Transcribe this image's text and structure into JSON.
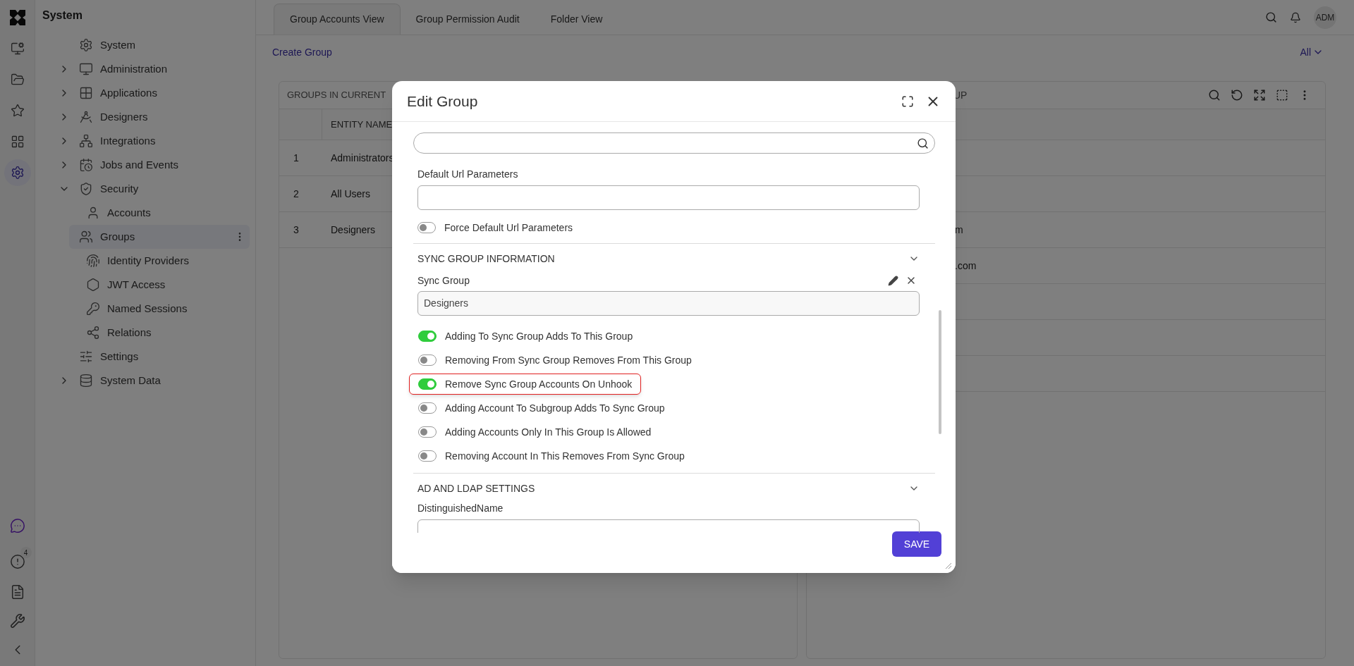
{
  "rail": {
    "top_items": [
      {
        "selected": false
      },
      {
        "selected": false
      },
      {
        "selected": false
      },
      {
        "selected": false
      },
      {
        "selected": true
      }
    ],
    "alert_badge": "4"
  },
  "sidebar": {
    "title": "System",
    "items": [
      {
        "label": "System",
        "selected": false
      },
      {
        "label": "Administration",
        "expanded": false,
        "selected": false
      },
      {
        "label": "Applications",
        "expanded": false,
        "selected": false
      },
      {
        "label": "Designers",
        "expanded": false,
        "selected": false
      },
      {
        "label": "Integrations",
        "expanded": false,
        "selected": false
      },
      {
        "label": "Jobs and Events",
        "expanded": false,
        "selected": false
      },
      {
        "label": "Security",
        "expanded": true,
        "selected": false,
        "children": [
          {
            "label": "Accounts",
            "selected": false
          },
          {
            "label": "Groups",
            "selected": true
          },
          {
            "label": "Identity Providers",
            "selected": false
          },
          {
            "label": "JWT Access",
            "selected": false
          },
          {
            "label": "Named Sessions",
            "selected": false
          },
          {
            "label": "Relations",
            "selected": false
          }
        ]
      },
      {
        "label": "Settings",
        "selected": false
      },
      {
        "label": "System Data",
        "expanded": false,
        "selected": false
      }
    ]
  },
  "tabs": [
    {
      "label": "Group Accounts View",
      "selected": true
    },
    {
      "label": "Group Permission Audit",
      "selected": false
    },
    {
      "label": "Folder View",
      "selected": false
    }
  ],
  "top_bar": {
    "avatar": "ADM"
  },
  "actions": {
    "create": "Create Group",
    "filter": "All"
  },
  "left_table": {
    "title": "GROUPS IN CURRENT",
    "columns": [
      "ENTITY NAME"
    ],
    "rows": [
      {
        "index": "1",
        "name": "Administrators"
      },
      {
        "index": "2",
        "name": "All Users"
      },
      {
        "index": "3",
        "name": "Designers"
      }
    ]
  },
  "right_table": {
    "title": "UP",
    "rows": [
      {},
      {},
      {
        "cell": "m"
      },
      {
        "cell": ".com"
      },
      {},
      {},
      {}
    ]
  },
  "modal": {
    "title": "Edit Group",
    "default_url": {
      "label": "Default Url Parameters"
    },
    "force_toggle": {
      "label": "Force Default Url Parameters",
      "on": false
    },
    "sync_section": {
      "title": "SYNC GROUP INFORMATION",
      "field_label": "Sync Group",
      "value": "Designers",
      "toggles": [
        {
          "label": "Adding To Sync Group Adds To This Group",
          "on": true,
          "highlighted": false
        },
        {
          "label": "Removing From Sync Group Removes From This Group",
          "on": false,
          "highlighted": false
        },
        {
          "label": "Remove Sync Group Accounts On Unhook",
          "on": true,
          "highlighted": true
        },
        {
          "label": "Adding Account To Subgroup Adds To Sync Group",
          "on": false,
          "highlighted": false
        },
        {
          "label": "Adding Accounts Only In This Group Is Allowed",
          "on": false,
          "highlighted": false
        },
        {
          "label": "Removing Account In This Removes From Sync Group",
          "on": false,
          "highlighted": false
        }
      ]
    },
    "ad_section": {
      "title": "AD AND LDAP SETTINGS",
      "field_label": "DistinguishedName"
    },
    "save": "SAVE"
  }
}
